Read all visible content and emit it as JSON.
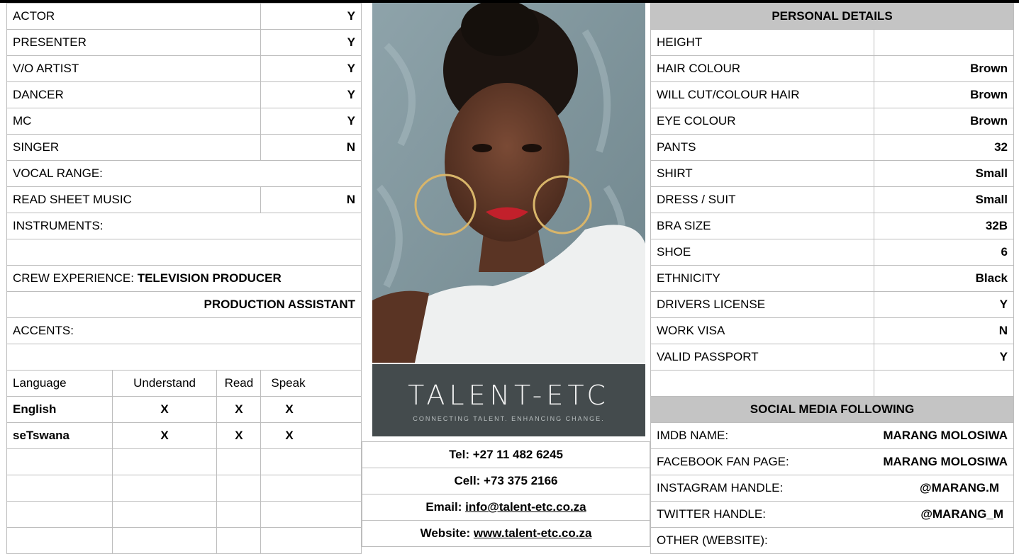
{
  "skills": [
    {
      "label": "ACTOR",
      "value": "Y"
    },
    {
      "label": "PRESENTER",
      "value": "Y"
    },
    {
      "label": "V/O ARTIST",
      "value": "Y"
    },
    {
      "label": "DANCER",
      "value": "Y"
    },
    {
      "label": "MC",
      "value": "Y"
    },
    {
      "label": "SINGER",
      "value": "N"
    }
  ],
  "vocal_range_label": "VOCAL RANGE:",
  "read_sheet_music": {
    "label": "READ SHEET MUSIC",
    "value": "N"
  },
  "instruments_label": "INSTRUMENTS:",
  "crew": {
    "label": "CREW EXPERIENCE: ",
    "role1": "TELEVISION PRODUCER",
    "role2": "PRODUCTION ASSISTANT"
  },
  "accents_label": "ACCENTS:",
  "languages": {
    "headers": [
      "Language",
      "Understand",
      "Read",
      "Speak"
    ],
    "rows": [
      {
        "name": "English",
        "understand": "X",
        "read": "X",
        "speak": "X"
      },
      {
        "name": "seTswana",
        "understand": "X",
        "read": "X",
        "speak": "X"
      }
    ]
  },
  "logo": {
    "name": "TALENT-ETC",
    "tagline": "CONNECTING TALENT. ENHANCING CHANGE."
  },
  "contact": {
    "tel": "Tel: +27 11 482 6245",
    "cell": "Cell: +73 375 2166",
    "email_label": "Email: ",
    "email": "info@talent-etc.co.za",
    "website_label": "Website: ",
    "website": "www.talent-etc.co.za"
  },
  "personal": {
    "title": "PERSONAL DETAILS",
    "rows": [
      {
        "label": "HEIGHT",
        "value": ""
      },
      {
        "label": "HAIR COLOUR",
        "value": "Brown"
      },
      {
        "label": "WILL CUT/COLOUR HAIR",
        "value": "Brown"
      },
      {
        "label": "EYE COLOUR",
        "value": "Brown"
      },
      {
        "label": "PANTS",
        "value": "32"
      },
      {
        "label": "SHIRT",
        "value": "Small"
      },
      {
        "label": "DRESS / SUIT",
        "value": "Small"
      },
      {
        "label": "BRA SIZE",
        "value": "32B"
      },
      {
        "label": "SHOE",
        "value": "6"
      },
      {
        "label": "ETHNICITY",
        "value": "Black"
      },
      {
        "label": "DRIVERS LICENSE",
        "value": "Y"
      },
      {
        "label": "WORK VISA",
        "value": "N"
      },
      {
        "label": "VALID PASSPORT",
        "value": "Y"
      }
    ]
  },
  "social": {
    "title": "SOCIAL MEDIA FOLLOWING",
    "rows": [
      {
        "label": "IMDB NAME:",
        "value": "MARANG MOLOSIWA"
      },
      {
        "label": "FACEBOOK FAN PAGE:",
        "value": "MARANG MOLOSIWA"
      },
      {
        "label": "INSTAGRAM HANDLE:",
        "value": "@MARANG.M"
      },
      {
        "label": "TWITTER HANDLE:",
        "value": "@MARANG_M"
      },
      {
        "label": "OTHER (WEBSITE):",
        "value": ""
      }
    ]
  },
  "colors": {
    "header_bg": "#c4c4c4",
    "logo_bg": "#444b4d",
    "border": "#bdbdbd"
  }
}
